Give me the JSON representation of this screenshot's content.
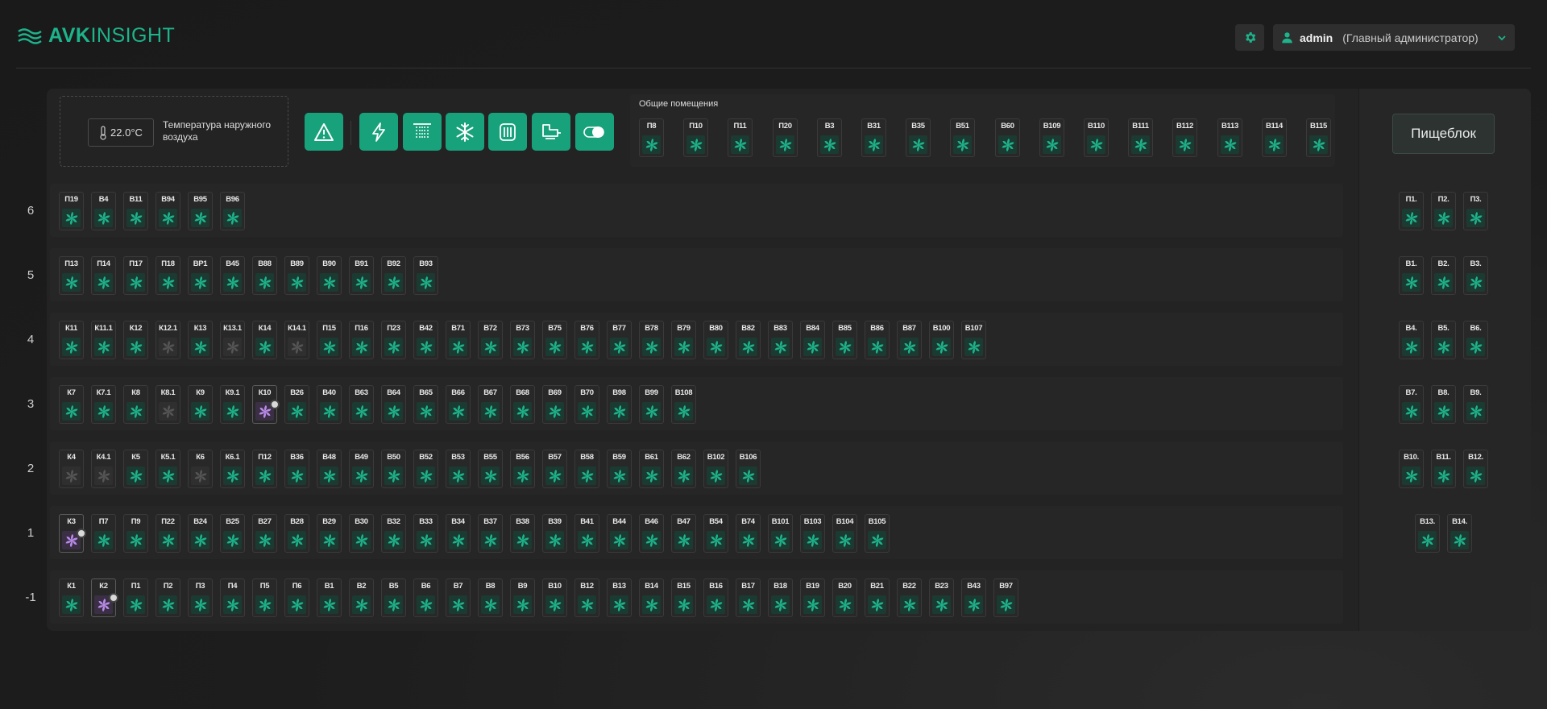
{
  "header": {
    "logo_bold": "AVK",
    "logo_rest": "INSIGHT",
    "user_name": "admin",
    "user_role": "(Главный администратор)"
  },
  "temperature": {
    "value": "22.0°C",
    "label": "Температура наружного воздуха"
  },
  "toolbar_icons": [
    "warning-icon",
    "power-icon",
    "ventilation-icon",
    "snowflake-icon",
    "heater-icon",
    "pump-icon",
    "toggle-icon"
  ],
  "common": {
    "title": "Общие помещения",
    "units": [
      "П8",
      "П10",
      "П11",
      "П20",
      "В3",
      "В31",
      "В35",
      "В51",
      "В60",
      "В109",
      "В110",
      "В111",
      "В112",
      "В113",
      "В114",
      "В115"
    ]
  },
  "pishe": {
    "title": "Пищеблок",
    "rows": [
      [
        "П1.",
        "П2.",
        "П3."
      ],
      [
        "В1.",
        "В2.",
        "В3."
      ],
      [
        "В4.",
        "В5.",
        "В6."
      ],
      [
        "В7.",
        "В8.",
        "В9."
      ],
      [
        "В10.",
        "В11.",
        "В12."
      ],
      [
        "В13.",
        "В14."
      ],
      []
    ]
  },
  "floors": [
    {
      "label": "6",
      "units": [
        "П19",
        "В4",
        "В11",
        "В94",
        "В95",
        "В96"
      ],
      "off": [],
      "alarm": []
    },
    {
      "label": "5",
      "units": [
        "П13",
        "П14",
        "П17",
        "П18",
        "ВР1",
        "В45",
        "В88",
        "В89",
        "В90",
        "В91",
        "В92",
        "В93"
      ],
      "off": [],
      "alarm": []
    },
    {
      "label": "4",
      "units": [
        "К11",
        "К11.1",
        "К12",
        "К12.1",
        "К13",
        "К13.1",
        "К14",
        "К14.1",
        "П15",
        "П16",
        "П23",
        "В42",
        "В71",
        "В72",
        "В73",
        "В75",
        "В76",
        "В77",
        "В78",
        "В79",
        "В80",
        "В82",
        "В83",
        "В84",
        "В85",
        "В86",
        "В87",
        "В100",
        "В107"
      ],
      "off": [
        "К12.1",
        "К13.1",
        "К14.1"
      ],
      "alarm": []
    },
    {
      "label": "3",
      "units": [
        "К7",
        "К7.1",
        "К8",
        "К8.1",
        "К9",
        "К9.1",
        "К10",
        "В26",
        "В40",
        "В63",
        "В64",
        "В65",
        "В66",
        "В67",
        "В68",
        "В69",
        "В70",
        "В98",
        "В99",
        "В108"
      ],
      "off": [
        "К8.1"
      ],
      "alarm": [
        "К10"
      ]
    },
    {
      "label": "2",
      "units": [
        "К4",
        "К4.1",
        "К5",
        "К5.1",
        "К6",
        "К6.1",
        "П12",
        "В36",
        "В48",
        "В49",
        "В50",
        "В52",
        "В53",
        "В55",
        "В56",
        "В57",
        "В58",
        "В59",
        "В61",
        "В62",
        "В102",
        "В106"
      ],
      "off": [
        "К4",
        "К4.1",
        "К6"
      ],
      "alarm": []
    },
    {
      "label": "1",
      "units": [
        "К3",
        "П7",
        "П9",
        "П22",
        "В24",
        "В25",
        "В27",
        "В28",
        "В29",
        "В30",
        "В32",
        "В33",
        "В34",
        "В37",
        "В38",
        "В39",
        "В41",
        "В44",
        "В46",
        "В47",
        "В54",
        "В74",
        "В101",
        "В103",
        "В104",
        "В105"
      ],
      "off": [],
      "alarm": [
        "К3"
      ]
    },
    {
      "label": "-1",
      "units": [
        "К1",
        "К2",
        "П1",
        "П2",
        "П3",
        "П4",
        "П5",
        "П6",
        "В1",
        "В2",
        "В5",
        "В6",
        "В7",
        "В8",
        "В9",
        "В10",
        "В12",
        "В13",
        "В14",
        "В15",
        "В16",
        "В17",
        "В18",
        "В19",
        "В20",
        "В21",
        "В22",
        "В23",
        "В43",
        "В97"
      ],
      "off": [],
      "alarm": [
        "К2"
      ]
    }
  ],
  "colors": {
    "accent": "#1db38b",
    "fan_on": "#1db38b",
    "fan_off": "#555555",
    "fan_alarm": "#b98be8"
  }
}
